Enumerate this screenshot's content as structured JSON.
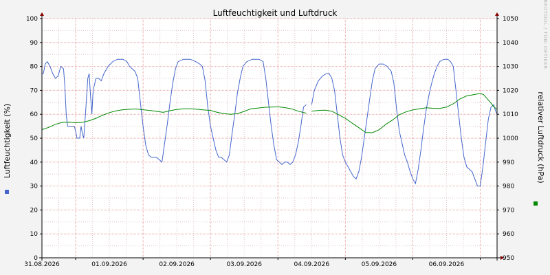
{
  "chart_data": {
    "type": "line",
    "title": "Luftfeuchtigkeit und Luftdruck",
    "ylabel_left": "Luftfeuchtigkeit (%)",
    "ylabel_right": "relativer Luftdruck (hPa)",
    "watermark": "RRDTOOL / TOBI OETIKER",
    "y_left": {
      "min": 0,
      "max": 100,
      "step": 10
    },
    "y_right": {
      "min": 950,
      "max": 1050,
      "step": 10
    },
    "x_range": [
      30.5,
      37.25
    ],
    "x_ticks": [
      {
        "x": 31.0,
        "label": "31.08.2026"
      },
      {
        "x": 32.0,
        "label": "01.09.2026"
      },
      {
        "x": 33.0,
        "label": "02.09.2026"
      },
      {
        "x": 34.0,
        "label": "03.09.2026"
      },
      {
        "x": 35.0,
        "label": "04.09.2026"
      },
      {
        "x": 36.0,
        "label": "05.09.2026"
      },
      {
        "x": 37.0,
        "label": "06.09.2026"
      }
    ],
    "grid": true,
    "colors": {
      "humidity": "#4466cc",
      "pressure": "#008800",
      "major_grid": "#e8a0a0",
      "minor_grid": "#e0c8c8",
      "plot_bg": "#ffffff",
      "axis": "#000000",
      "arrow": "#880000"
    },
    "series": [
      {
        "axis": "left",
        "points": [
          [
            30.5,
            77
          ],
          [
            30.52,
            77
          ],
          [
            30.55,
            81
          ],
          [
            30.58,
            82
          ],
          [
            30.62,
            80
          ],
          [
            30.66,
            77
          ],
          [
            30.7,
            75
          ],
          [
            30.74,
            76
          ],
          [
            30.78,
            80
          ],
          [
            30.82,
            79
          ],
          [
            30.84,
            72
          ],
          [
            30.86,
            60
          ],
          [
            30.88,
            55
          ],
          [
            30.92,
            55
          ],
          [
            30.96,
            55
          ],
          [
            30.98,
            55
          ],
          [
            31.0,
            53
          ],
          [
            31.02,
            50
          ],
          [
            31.06,
            50
          ],
          [
            31.08,
            55
          ],
          [
            31.1,
            52
          ],
          [
            31.12,
            50
          ],
          [
            31.14,
            58
          ],
          [
            31.16,
            66
          ],
          [
            31.18,
            75
          ],
          [
            31.2,
            77
          ],
          [
            31.22,
            68
          ],
          [
            31.24,
            60
          ],
          [
            31.26,
            70
          ],
          [
            31.3,
            75
          ],
          [
            31.34,
            75
          ],
          [
            31.38,
            74
          ],
          [
            31.42,
            77
          ],
          [
            31.48,
            80
          ],
          [
            31.55,
            82
          ],
          [
            31.62,
            83
          ],
          [
            31.7,
            83
          ],
          [
            31.76,
            82
          ],
          [
            31.8,
            80
          ],
          [
            31.84,
            79
          ],
          [
            31.88,
            78
          ],
          [
            31.92,
            75
          ],
          [
            31.96,
            65
          ],
          [
            32.0,
            55
          ],
          [
            32.04,
            47
          ],
          [
            32.08,
            43
          ],
          [
            32.12,
            42
          ],
          [
            32.16,
            42
          ],
          [
            32.2,
            42
          ],
          [
            32.24,
            41
          ],
          [
            32.28,
            40
          ],
          [
            32.32,
            48
          ],
          [
            32.36,
            56
          ],
          [
            32.4,
            65
          ],
          [
            32.44,
            73
          ],
          [
            32.48,
            79
          ],
          [
            32.52,
            82
          ],
          [
            32.6,
            83
          ],
          [
            32.7,
            83
          ],
          [
            32.78,
            82
          ],
          [
            32.84,
            81
          ],
          [
            32.88,
            80
          ],
          [
            32.92,
            74
          ],
          [
            32.96,
            63
          ],
          [
            33.0,
            55
          ],
          [
            33.04,
            50
          ],
          [
            33.08,
            45
          ],
          [
            33.12,
            42
          ],
          [
            33.16,
            42
          ],
          [
            33.2,
            41
          ],
          [
            33.24,
            40
          ],
          [
            33.28,
            43
          ],
          [
            33.32,
            52
          ],
          [
            33.36,
            60
          ],
          [
            33.4,
            69
          ],
          [
            33.44,
            75
          ],
          [
            33.48,
            80
          ],
          [
            33.54,
            82
          ],
          [
            33.62,
            83
          ],
          [
            33.72,
            83
          ],
          [
            33.78,
            82
          ],
          [
            33.82,
            75
          ],
          [
            33.86,
            65
          ],
          [
            33.9,
            55
          ],
          [
            33.94,
            47
          ],
          [
            33.98,
            41
          ],
          [
            34.02,
            40
          ],
          [
            34.06,
            39
          ],
          [
            34.1,
            40
          ],
          [
            34.14,
            40
          ],
          [
            34.18,
            39
          ],
          [
            34.22,
            40
          ],
          [
            34.26,
            43
          ],
          [
            34.3,
            48
          ],
          [
            34.34,
            55
          ],
          [
            34.38,
            63
          ],
          [
            34.42,
            64
          ],
          [
            34.44,
            null
          ],
          [
            34.5,
            64
          ],
          [
            34.54,
            70
          ],
          [
            34.6,
            74
          ],
          [
            34.66,
            76
          ],
          [
            34.72,
            77
          ],
          [
            34.76,
            77
          ],
          [
            34.8,
            75
          ],
          [
            34.84,
            70
          ],
          [
            34.88,
            60
          ],
          [
            34.92,
            50
          ],
          [
            34.96,
            43
          ],
          [
            35.0,
            40
          ],
          [
            35.04,
            38
          ],
          [
            35.08,
            36
          ],
          [
            35.12,
            34
          ],
          [
            35.16,
            33
          ],
          [
            35.2,
            36
          ],
          [
            35.24,
            42
          ],
          [
            35.28,
            50
          ],
          [
            35.32,
            58
          ],
          [
            35.36,
            66
          ],
          [
            35.4,
            74
          ],
          [
            35.44,
            79
          ],
          [
            35.5,
            81
          ],
          [
            35.56,
            81
          ],
          [
            35.62,
            80
          ],
          [
            35.68,
            78
          ],
          [
            35.72,
            73
          ],
          [
            35.76,
            62
          ],
          [
            35.8,
            53
          ],
          [
            35.84,
            48
          ],
          [
            35.88,
            43
          ],
          [
            35.92,
            40
          ],
          [
            35.96,
            36
          ],
          [
            36.0,
            33
          ],
          [
            36.04,
            31
          ],
          [
            36.08,
            37
          ],
          [
            36.12,
            45
          ],
          [
            36.16,
            54
          ],
          [
            36.2,
            62
          ],
          [
            36.24,
            68
          ],
          [
            36.28,
            73
          ],
          [
            36.32,
            77
          ],
          [
            36.36,
            80
          ],
          [
            36.4,
            82
          ],
          [
            36.46,
            83
          ],
          [
            36.52,
            83
          ],
          [
            36.56,
            82
          ],
          [
            36.6,
            80
          ],
          [
            36.64,
            70
          ],
          [
            36.68,
            60
          ],
          [
            36.72,
            50
          ],
          [
            36.76,
            42
          ],
          [
            36.8,
            38
          ],
          [
            36.84,
            37
          ],
          [
            36.88,
            36
          ],
          [
            36.92,
            33
          ],
          [
            36.96,
            30
          ],
          [
            37.0,
            30
          ],
          [
            37.04,
            38
          ],
          [
            37.08,
            48
          ],
          [
            37.12,
            58
          ],
          [
            37.16,
            63
          ],
          [
            37.2,
            64
          ],
          [
            37.22,
            62
          ],
          [
            37.25,
            60
          ]
        ]
      },
      {
        "axis": "right",
        "points": [
          [
            30.5,
            1003.6
          ],
          [
            30.6,
            1004.5
          ],
          [
            30.7,
            1005.8
          ],
          [
            30.8,
            1006.6
          ],
          [
            30.9,
            1006.7
          ],
          [
            31.0,
            1006.5
          ],
          [
            31.1,
            1006.6
          ],
          [
            31.2,
            1007.3
          ],
          [
            31.3,
            1008.3
          ],
          [
            31.4,
            1009.6
          ],
          [
            31.5,
            1010.7
          ],
          [
            31.6,
            1011.4
          ],
          [
            31.7,
            1011.9
          ],
          [
            31.8,
            1012.1
          ],
          [
            31.9,
            1012.2
          ],
          [
            32.0,
            1011.9
          ],
          [
            32.1,
            1011.6
          ],
          [
            32.2,
            1011.2
          ],
          [
            32.3,
            1010.8
          ],
          [
            32.4,
            1011.5
          ],
          [
            32.5,
            1012.0
          ],
          [
            32.6,
            1012.3
          ],
          [
            32.7,
            1012.3
          ],
          [
            32.8,
            1012.1
          ],
          [
            32.9,
            1011.8
          ],
          [
            33.0,
            1011.6
          ],
          [
            33.1,
            1010.8
          ],
          [
            33.2,
            1010.3
          ],
          [
            33.3,
            1010.0
          ],
          [
            33.4,
            1010.3
          ],
          [
            33.5,
            1011.2
          ],
          [
            33.6,
            1012.3
          ],
          [
            33.7,
            1012.6
          ],
          [
            33.8,
            1012.9
          ],
          [
            33.9,
            1013.0
          ],
          [
            34.0,
            1013.1
          ],
          [
            34.1,
            1012.8
          ],
          [
            34.2,
            1012.3
          ],
          [
            34.3,
            1011.3
          ],
          [
            34.4,
            1010.6
          ],
          [
            34.42,
            1010.4
          ],
          [
            34.44,
            null
          ],
          [
            34.5,
            1011.3
          ],
          [
            34.6,
            1011.6
          ],
          [
            34.7,
            1011.7
          ],
          [
            34.8,
            1011.3
          ],
          [
            34.9,
            1009.8
          ],
          [
            35.0,
            1008.3
          ],
          [
            35.1,
            1006.3
          ],
          [
            35.2,
            1004.4
          ],
          [
            35.3,
            1002.4
          ],
          [
            35.4,
            1002.3
          ],
          [
            35.5,
            1003.5
          ],
          [
            35.6,
            1005.8
          ],
          [
            35.7,
            1007.6
          ],
          [
            35.8,
            1009.8
          ],
          [
            35.9,
            1011.0
          ],
          [
            36.0,
            1011.8
          ],
          [
            36.1,
            1012.3
          ],
          [
            36.2,
            1012.7
          ],
          [
            36.3,
            1012.5
          ],
          [
            36.4,
            1012.4
          ],
          [
            36.5,
            1013.0
          ],
          [
            36.6,
            1014.4
          ],
          [
            36.7,
            1016.4
          ],
          [
            36.8,
            1017.7
          ],
          [
            36.9,
            1018.2
          ],
          [
            37.0,
            1018.7
          ],
          [
            37.05,
            1018.2
          ],
          [
            37.1,
            1016.6
          ],
          [
            37.15,
            1015.0
          ],
          [
            37.2,
            1013.2
          ],
          [
            37.25,
            1012.0
          ]
        ]
      }
    ],
    "legend_markers": {
      "left": "#4466cc",
      "right": "#008800"
    }
  }
}
